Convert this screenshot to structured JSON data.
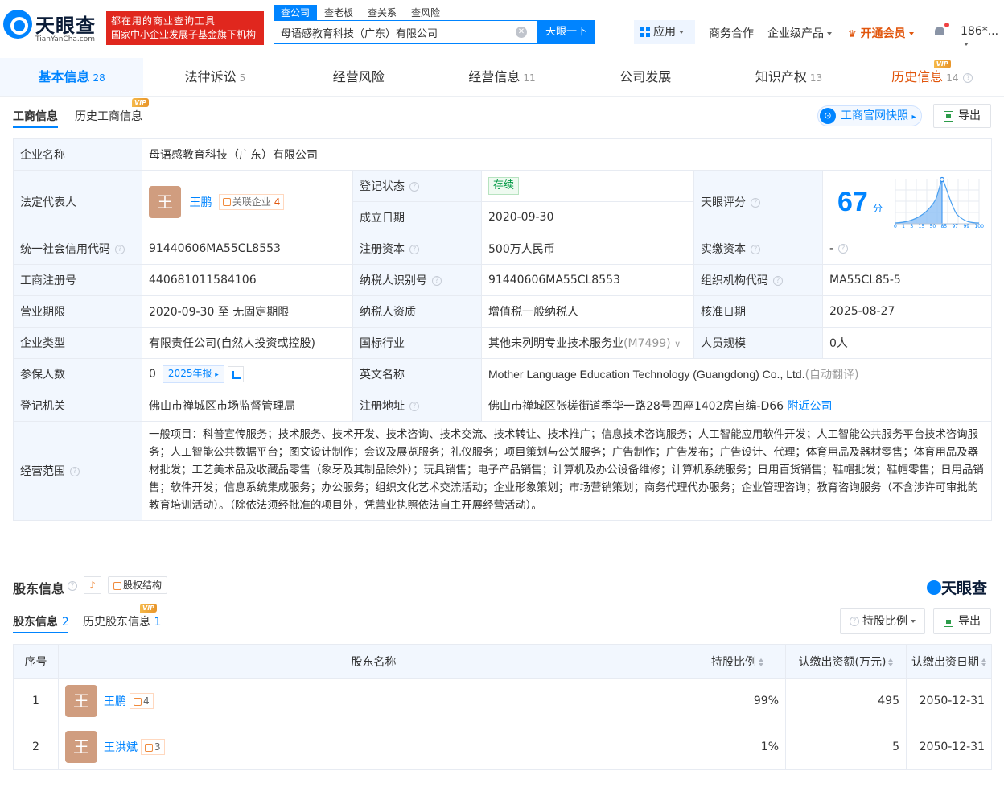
{
  "header": {
    "logo_text": "天眼查",
    "logo_sub": "TianYanCha.com",
    "slogan_line1": "都在用的商业查询工具",
    "slogan_line2": "国家中小企业发展子基金旗下机构",
    "search_tabs": [
      "查公司",
      "查老板",
      "查关系",
      "查风险"
    ],
    "search_value": "母语感教育科技（广东）有限公司",
    "search_button": "天眼一下",
    "app_label": "应用",
    "nav_business": "商务合作",
    "nav_enterprise": "企业级产品",
    "nav_vip": "开通会员",
    "user": "186*..."
  },
  "main_tabs": [
    {
      "label": "基本信息",
      "count": "28"
    },
    {
      "label": "法律诉讼",
      "count": "5"
    },
    {
      "label": "经营风险",
      "count": ""
    },
    {
      "label": "经营信息",
      "count": "11"
    },
    {
      "label": "公司发展",
      "count": ""
    },
    {
      "label": "知识产权",
      "count": "13"
    },
    {
      "label": "历史信息",
      "count": "14"
    }
  ],
  "vip_badge": "VIP",
  "biz_tabs": {
    "current": "工商信息",
    "history": "历史工商信息"
  },
  "snapshot_button": "工商官网快照",
  "export_button": "导出",
  "info": {
    "company_name_label": "企业名称",
    "company_name": "母语感教育科技（广东）有限公司",
    "legal_rep_label": "法定代表人",
    "legal_rep_avatar": "王",
    "legal_rep": "王鹏",
    "legal_rep_related": "关联企业",
    "legal_rep_related_count": "4",
    "reg_status_label": "登记状态",
    "reg_status": "存续",
    "found_date_label": "成立日期",
    "found_date": "2020-09-30",
    "score_label": "天眼评分",
    "score": "67",
    "score_unit": "分",
    "score_ticks": [
      "0",
      "1",
      "3",
      "15",
      "50",
      "85",
      "97",
      "99",
      "100"
    ],
    "credit_code_label": "统一社会信用代码",
    "credit_code": "91440606MA55CL8553",
    "reg_capital_label": "注册资本",
    "reg_capital": "500万人民币",
    "paid_capital_label": "实缴资本",
    "paid_capital": "-",
    "reg_no_label": "工商注册号",
    "reg_no": "440681011584106",
    "taxpayer_id_label": "纳税人识别号",
    "taxpayer_id": "91440606MA55CL8553",
    "org_code_label": "组织机构代码",
    "org_code": "MA55CL85-5",
    "term_label": "营业期限",
    "term": "2020-09-30 至 无固定期限",
    "taxpayer_qual_label": "纳税人资质",
    "taxpayer_qual": "增值税一般纳税人",
    "approve_date_label": "核准日期",
    "approve_date": "2025-08-27",
    "type_label": "企业类型",
    "type": "有限责任公司(自然人投资或控股)",
    "industry_label": "国标行业",
    "industry": "其他未列明专业技术服务业",
    "industry_code": "(M7499)",
    "staff_label": "人员规模",
    "staff": "0人",
    "insured_label": "参保人数",
    "insured": "0",
    "insured_report": "2025年报",
    "english_name_label": "英文名称",
    "english_name": "Mother Language Education Technology (Guangdong) Co., Ltd.",
    "english_name_note": "(自动翻译)",
    "authority_label": "登记机关",
    "authority": "佛山市禅城区市场监督管理局",
    "address_label": "注册地址",
    "address": "佛山市禅城区张槎街道季华一路28号四座1402房自编-D66",
    "address_link": "附近公司",
    "scope_label": "经营范围",
    "scope": "一般项目：科普宣传服务；技术服务、技术开发、技术咨询、技术交流、技术转让、技术推广；信息技术咨询服务；人工智能应用软件开发；人工智能公共服务平台技术咨询服务；人工智能公共数据平台；图文设计制作；会议及展览服务；礼仪服务；项目策划与公关服务；广告制作；广告发布；广告设计、代理；体育用品及器材零售；体育用品及器材批发；工艺美术品及收藏品零售（象牙及其制品除外）；玩具销售；电子产品销售；计算机及办公设备维修；计算机系统服务；日用百货销售；鞋帽批发；鞋帽零售；日用品销售；软件开发；信息系统集成服务；办公服务；组织文化艺术交流活动；企业形象策划；市场营销策划；商务代理代办服务；企业管理咨询；教育咨询服务（不含涉许可审批的教育培训活动）。（除依法须经批准的项目外，凭营业执照依法自主开展经营活动）。"
  },
  "shareholders": {
    "title": "股东信息",
    "equity_button": "股权结构",
    "brand": "天眼查",
    "tab_current": "股东信息",
    "tab_current_count": "2",
    "tab_history": "历史股东信息",
    "tab_history_count": "1",
    "ratio_filter": "持股比例",
    "export": "导出",
    "columns": [
      "序号",
      "股东名称",
      "持股比例",
      "认缴出资额(万元)",
      "认缴出资日期"
    ],
    "rows": [
      {
        "no": "1",
        "avatar": "王",
        "name": "王鹏",
        "related": "4",
        "ratio": "99%",
        "amount": "495",
        "date": "2050-12-31"
      },
      {
        "no": "2",
        "avatar": "王",
        "name": "王洪斌",
        "related": "3",
        "ratio": "1%",
        "amount": "5",
        "date": "2050-12-31"
      }
    ]
  }
}
